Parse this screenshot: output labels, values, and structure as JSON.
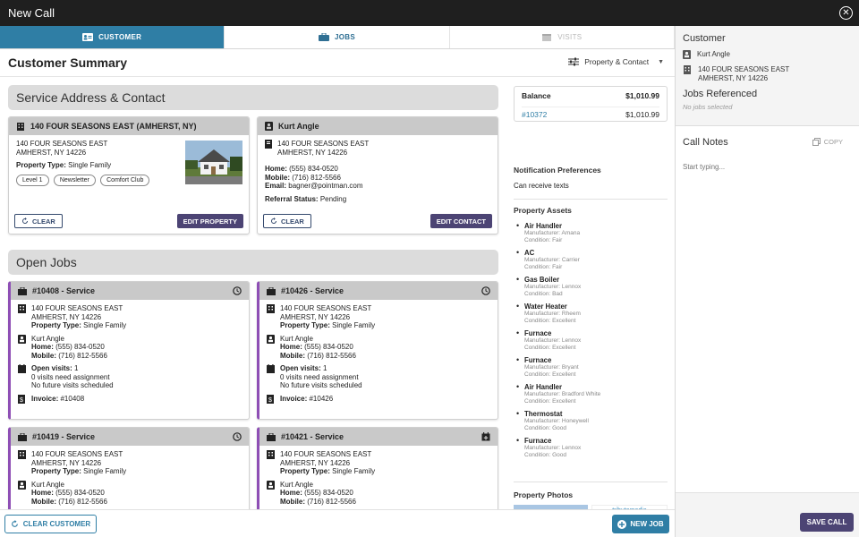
{
  "window": {
    "title": "New Call"
  },
  "tabs": [
    {
      "label": "CUSTOMER",
      "state": "active"
    },
    {
      "label": "JOBS",
      "state": "normal"
    },
    {
      "label": "VISITS",
      "state": "disabled"
    }
  ],
  "summary": {
    "title": "Customer Summary",
    "filter_label": "Property & Contact"
  },
  "sections": {
    "service_address": "Service Address & Contact",
    "open_jobs": "Open Jobs"
  },
  "property_card": {
    "title": "140 FOUR SEASONS EAST (AMHERST, NY)",
    "address_line1": "140 FOUR SEASONS EAST",
    "address_line2": "AMHERST, NY 14226",
    "type_label": "Property Type:",
    "type_value": "Single Family",
    "tags": [
      "Level 1",
      "Newsletter",
      "Comfort Club"
    ],
    "clear_label": "CLEAR",
    "edit_label": "EDIT PROPERTY"
  },
  "contact_card": {
    "title": "Kurt Angle",
    "address_line1": "140 FOUR SEASONS EAST",
    "address_line2": "AMHERST, NY 14226",
    "home_label": "Home:",
    "home_value": "(555) 834-0520",
    "mobile_label": "Mobile:",
    "mobile_value": "(716) 812-5566",
    "email_label": "Email:",
    "email_value": "bagner@pointman.com",
    "referral_label": "Referral Status:",
    "referral_value": "Pending",
    "clear_label": "CLEAR",
    "edit_label": "EDIT CONTACT"
  },
  "jobs": [
    {
      "title": "#10408 - Service",
      "icon": "clock-icon",
      "addr1": "140 FOUR SEASONS EAST",
      "addr2": "AMHERST, NY 14226",
      "ptype_label": "Property Type:",
      "ptype": "Single Family",
      "name": "Kurt Angle",
      "home_label": "Home:",
      "home": "(555) 834-0520",
      "mobile_label": "Mobile:",
      "mobile": "(716) 812-5566",
      "visits_label": "Open visits:",
      "visits": "1",
      "need": "0 visits need assignment",
      "future": "No future visits scheduled",
      "invoice_label": "Invoice:",
      "invoice": "#10408"
    },
    {
      "title": "#10426 - Service",
      "icon": "clock-icon",
      "addr1": "140 FOUR SEASONS EAST",
      "addr2": "AMHERST, NY 14226",
      "ptype_label": "Property Type:",
      "ptype": "Single Family",
      "name": "Kurt Angle",
      "home_label": "Home:",
      "home": "(555) 834-0520",
      "mobile_label": "Mobile:",
      "mobile": "(716) 812-5566",
      "visits_label": "Open visits:",
      "visits": "1",
      "need": "0 visits need assignment",
      "future": "No future visits scheduled",
      "invoice_label": "Invoice:",
      "invoice": "#10426"
    },
    {
      "title": "#10419 - Service",
      "icon": "clock-icon",
      "addr1": "140 FOUR SEASONS EAST",
      "addr2": "AMHERST, NY 14226",
      "ptype_label": "Property Type:",
      "ptype": "Single Family",
      "name": "Kurt Angle",
      "home_label": "Home:",
      "home": "(555) 834-0520",
      "mobile_label": "Mobile:",
      "mobile": "(716) 812-5566"
    },
    {
      "title": "#10421 - Service",
      "icon": "calendar-plus-icon",
      "addr1": "140 FOUR SEASONS EAST",
      "addr2": "AMHERST, NY 14226",
      "ptype_label": "Property Type:",
      "ptype": "Single Family",
      "name": "Kurt Angle",
      "home_label": "Home:",
      "home": "(555) 834-0520",
      "mobile_label": "Mobile:",
      "mobile": "(716) 812-5566"
    }
  ],
  "balance": {
    "label": "Balance",
    "total": "$1,010.99",
    "invoice": "#10372",
    "invoice_amount": "$1,010.99"
  },
  "notifications": {
    "title": "Notification Preferences",
    "value": "Can receive texts"
  },
  "assets": {
    "title": "Property Assets",
    "items": [
      {
        "name": "Air Handler",
        "manufacturer": "Manufacturer: Amana",
        "condition": "Condition: Fair"
      },
      {
        "name": "AC",
        "manufacturer": "Manufacturer: Carrier",
        "condition": "Condition: Fair"
      },
      {
        "name": "Gas Boiler",
        "manufacturer": "Manufacturer: Lennox",
        "condition": "Condition: Bad"
      },
      {
        "name": "Water Heater",
        "manufacturer": "Manufacturer: Rheem",
        "condition": "Condition: Excellent"
      },
      {
        "name": "Furnace",
        "manufacturer": "Manufacturer: Lennox",
        "condition": "Condition: Excellent"
      },
      {
        "name": "Furnace",
        "manufacturer": "Manufacturer: Bryant",
        "condition": "Condition: Excellent"
      },
      {
        "name": "Air Handler",
        "manufacturer": "Manufacturer: Bradford White",
        "condition": "Condition: Excellent"
      },
      {
        "name": "Thermostat",
        "manufacturer": "Manufacturer: Honeywell",
        "condition": "Condition: Good"
      },
      {
        "name": "Furnace",
        "manufacturer": "Manufacturer: Lennox",
        "condition": "Condition: Good"
      }
    ]
  },
  "photos": {
    "title": "Property Photos",
    "thumb_text": "tributemedia"
  },
  "bottom": {
    "clear_customer": "CLEAR CUSTOMER",
    "new_job": "NEW JOB"
  },
  "right_panel": {
    "customer_title": "Customer",
    "customer_name": "Kurt Angle",
    "customer_addr1": "140 FOUR SEASONS EAST",
    "customer_addr2": "AMHERST, NY 14226",
    "jobs_title": "Jobs Referenced",
    "jobs_empty": "No jobs selected",
    "notes_title": "Call Notes",
    "copy_label": "COPY",
    "notes_placeholder": "Start typing...",
    "save_label": "SAVE CALL"
  },
  "colors": {
    "primary": "#2f7ea5",
    "secondary": "#4c4474",
    "job_accent": "#8e4fb5",
    "titlebar": "#1f1f1f"
  }
}
